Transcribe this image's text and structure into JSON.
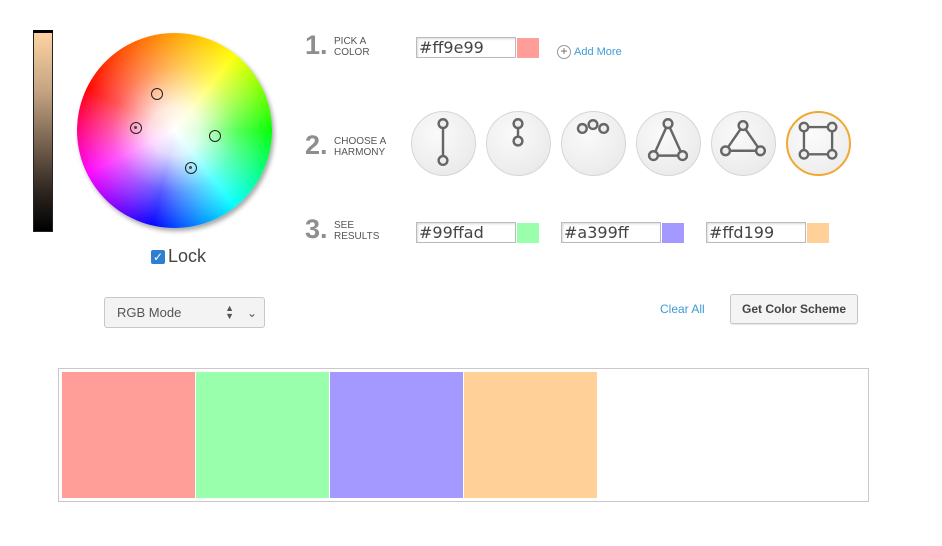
{
  "lock": {
    "label": "Lock",
    "checked": true
  },
  "mode": {
    "selected": "RGB Mode"
  },
  "steps": [
    {
      "number": "1.",
      "line1": "PICK A",
      "line2": "COLOR"
    },
    {
      "number": "2.",
      "line1": "CHOOSE A",
      "line2": "HARMONY"
    },
    {
      "number": "3.",
      "line1": "SEE",
      "line2": "RESULTS"
    }
  ],
  "pick": {
    "hex": "#ff9e99",
    "color": "#ff9e99",
    "add_more": "Add More"
  },
  "results": [
    {
      "hex": "#99ffad",
      "color": "#99ffad"
    },
    {
      "hex": "#a399ff",
      "color": "#a399ff"
    },
    {
      "hex": "#ffd199",
      "color": "#ffd199"
    }
  ],
  "harmonies": [
    {
      "name": "complementary-icon",
      "active": false
    },
    {
      "name": "split-complementary-icon",
      "active": false
    },
    {
      "name": "analogous-icon",
      "active": false
    },
    {
      "name": "triad-icon",
      "active": false
    },
    {
      "name": "triad-alt-icon",
      "active": false
    },
    {
      "name": "square-icon",
      "active": true
    }
  ],
  "actions": {
    "clear_all": "Clear All",
    "get_scheme": "Get Color Scheme"
  },
  "palette": [
    "#ff9e99",
    "#99ffad",
    "#a399ff",
    "#ffd199"
  ],
  "colors": {
    "link": "#3d9bd6",
    "active_harmony_border": "#f0a830",
    "lock_checkbox": "#2f7fd1"
  }
}
